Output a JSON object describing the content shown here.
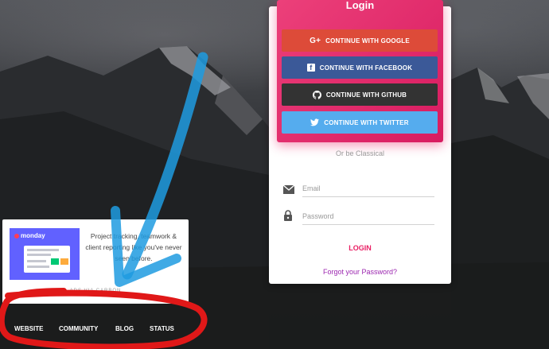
{
  "card": {
    "title": "Login",
    "social": {
      "google": "CONTINUE WITH GOOGLE",
      "facebook": "CONTINUE WITH FACEBOOK",
      "github": "CONTINUE WITH GITHUB",
      "twitter": "CONTINUE WITH TWITTER"
    },
    "divider_text": "Or be Classical",
    "email_placeholder": "Email",
    "password_placeholder": "Password",
    "login_label": "LOGIN",
    "forgot_label": "Forgot your Password?"
  },
  "ad": {
    "brand": "monday",
    "text": "Project tracking, teamwork & client reporting like you've never seen before.",
    "via": "ADS VIA CARBON"
  },
  "footer": {
    "links": [
      "WEBSITE",
      "COMMUNITY",
      "BLOG",
      "STATUS"
    ]
  },
  "colors": {
    "header_gradient": [
      "#ec407a",
      "#d81b60"
    ],
    "google": "#dd4b39",
    "facebook": "#3b5998",
    "github": "#333333",
    "twitter": "#55acee",
    "accent": "#e91e63",
    "forgot": "#9c27b0",
    "annotation_arrow": "#1e9be0",
    "annotation_circle": "#e01818"
  }
}
